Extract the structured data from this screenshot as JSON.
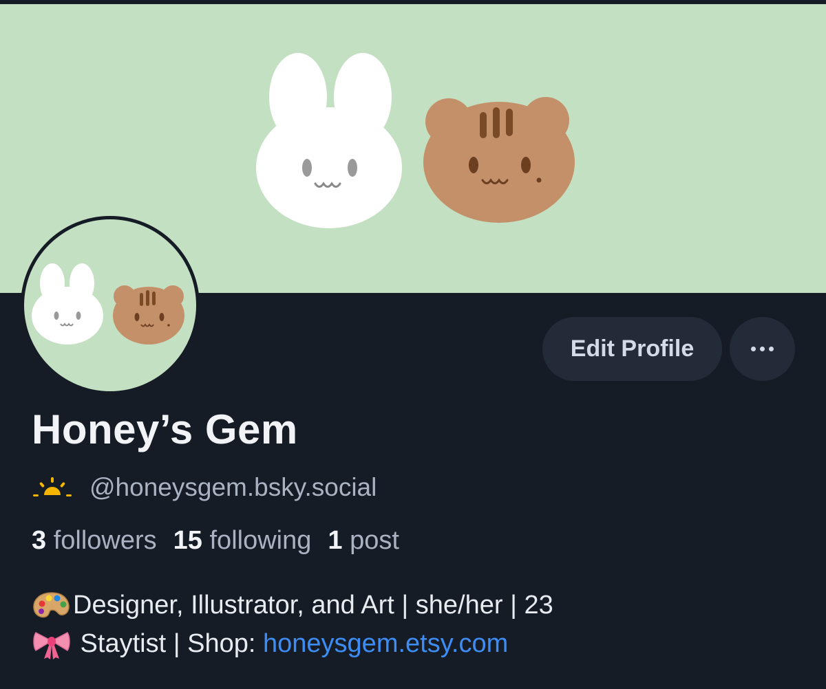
{
  "profile": {
    "display_name": "Honey’s Gem",
    "handle": "@honeysgem.bsky.social",
    "handle_icon": "sunrise-icon",
    "stats": {
      "followers_count": "3",
      "followers_label": "followers",
      "following_count": "15",
      "following_label": "following",
      "posts_count": "1",
      "posts_label": "post"
    },
    "bio": {
      "line1_icon": "artist-palette-icon",
      "line1_text": "Designer, Illustrator, and Art | she/her | 23",
      "line2_icon": "ribbon-icon",
      "line2_text": " Staytist | Shop: ",
      "line2_link": "honeysgem.etsy.com"
    }
  },
  "actions": {
    "edit_profile_label": "Edit Profile",
    "more_icon": "more-options-icon"
  },
  "colors": {
    "background": "#161c26",
    "banner": "#c4e0c2",
    "button": "#232b38",
    "link": "#3d8df5",
    "bunny": "#ffffff",
    "squirrel": "#c4906a"
  }
}
